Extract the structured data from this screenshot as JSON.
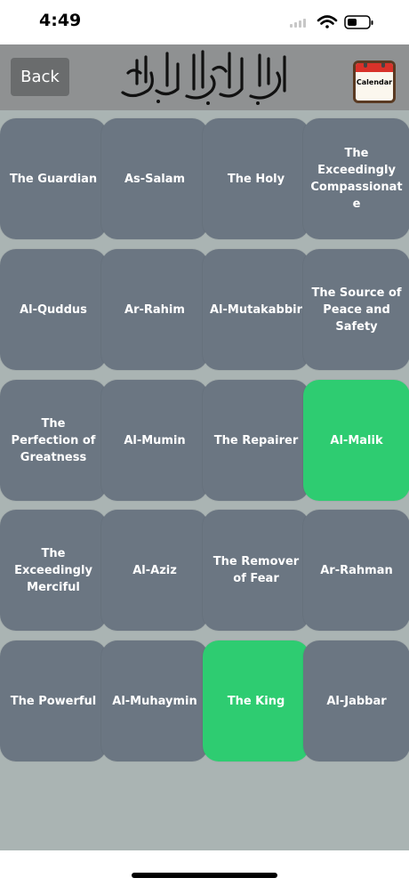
{
  "status": {
    "time": "4:49"
  },
  "header": {
    "back_label": "Back",
    "calendar_label": "Calendar"
  },
  "colors": {
    "tile": "#6b7682",
    "tile_highlight": "#2ecc71",
    "content_bg": "#aab4b3",
    "header_bg": "#8f9192"
  },
  "grid": {
    "rows": [
      [
        {
          "label": "The Guardian",
          "highlighted": false
        },
        {
          "label": "As-Salam",
          "highlighted": false
        },
        {
          "label": "The Holy",
          "highlighted": false
        },
        {
          "label": "The Exceedingly Compassionate",
          "highlighted": false
        }
      ],
      [
        {
          "label": "Al-Quddus",
          "highlighted": false
        },
        {
          "label": "Ar-Rahim",
          "highlighted": false
        },
        {
          "label": "Al-Mutakabbir",
          "highlighted": false
        },
        {
          "label": "The Source of Peace and Safety",
          "highlighted": false
        }
      ],
      [
        {
          "label": "The Perfection of Greatness",
          "highlighted": false
        },
        {
          "label": "Al-Mumin",
          "highlighted": false
        },
        {
          "label": "The Repairer",
          "highlighted": false
        },
        {
          "label": "Al-Malik",
          "highlighted": true
        }
      ],
      [
        {
          "label": "The Exceedingly Merciful",
          "highlighted": false
        },
        {
          "label": "Al-Aziz",
          "highlighted": false
        },
        {
          "label": "The Remover of Fear",
          "highlighted": false
        },
        {
          "label": "Ar-Rahman",
          "highlighted": false
        }
      ],
      [
        {
          "label": "The Powerful",
          "highlighted": false
        },
        {
          "label": "Al-Muhaymin",
          "highlighted": false
        },
        {
          "label": "The King",
          "highlighted": true
        },
        {
          "label": "Al-Jabbar",
          "highlighted": false
        }
      ]
    ]
  }
}
